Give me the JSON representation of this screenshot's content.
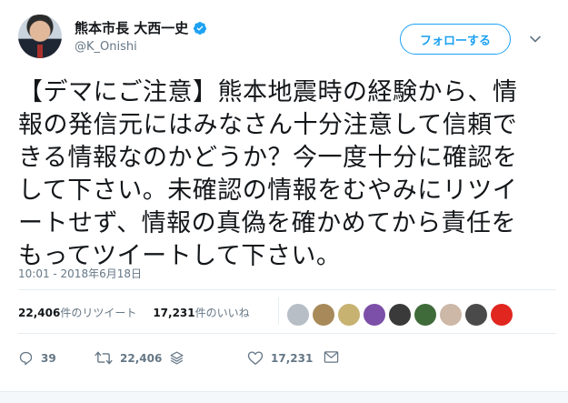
{
  "author": {
    "display_name": "熊本市長 大西一史",
    "handle": "@K_Onishi",
    "verified": true
  },
  "follow_button": {
    "label": "フォローする"
  },
  "tweet": {
    "text": "【デマにご注意】熊本地震時の経験から、情\n報の発信元にはみなさん十分注意して信頼で\nきる情報なのかどうか？今一度十分に確認を\nして下さい。未確認の情報をむやみにリツイ\nートせず、情報の真偽を確かめてから責任を\nもってツイートして下さい。",
    "timestamp": "10:01 - 2018年6月18日"
  },
  "stats": {
    "retweets_count": "22,406",
    "retweets_suffix": "件のリツイート",
    "likes_count": "17,231",
    "likes_suffix": "件のいいね"
  },
  "likers": [
    {
      "name": "liker-1",
      "color": "#b7bec6"
    },
    {
      "name": "liker-2",
      "color": "#a88a5a"
    },
    {
      "name": "liker-3",
      "color": "#c7b271"
    },
    {
      "name": "liker-4",
      "color": "#7c4fa8"
    },
    {
      "name": "liker-5",
      "color": "#3a3a3a"
    },
    {
      "name": "liker-6",
      "color": "#3f6b3a"
    },
    {
      "name": "liker-7",
      "color": "#cdb8a8"
    },
    {
      "name": "liker-8",
      "color": "#4a4a4a"
    },
    {
      "name": "liker-9",
      "color": "#e0261f"
    }
  ],
  "actions": {
    "reply_count": "39",
    "retweet_count": "22,406",
    "like_count": "17,231"
  },
  "colors": {
    "accent": "#1da1f2",
    "text": "#14171a",
    "muted": "#657786"
  }
}
